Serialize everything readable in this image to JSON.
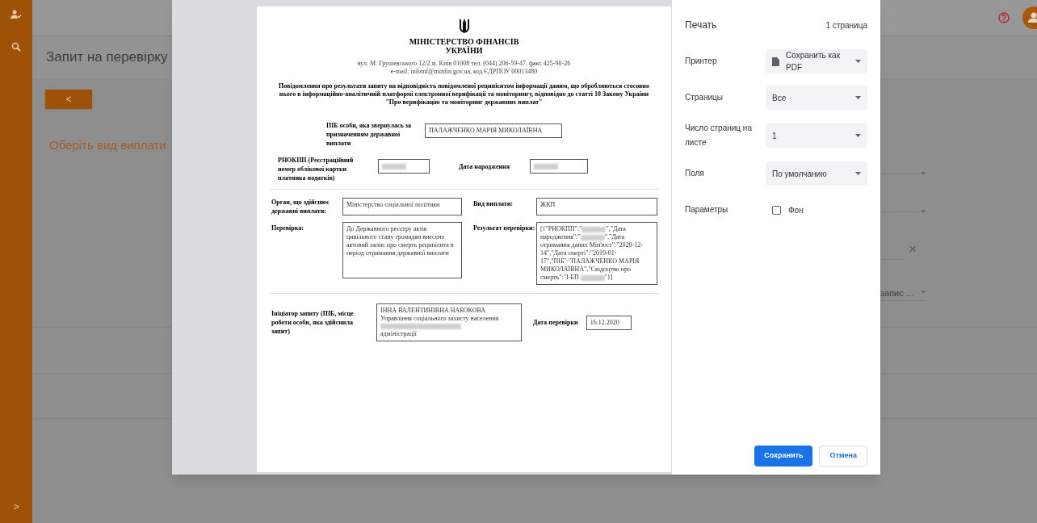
{
  "app": {
    "title": "Запит на перевірку",
    "back_button": "<",
    "section_label": "Оберіть вид виплати",
    "clear_button": "×",
    "truncated_value": "запис ...",
    "expand_button": ">"
  },
  "document": {
    "org_name": [
      "МІНІСТЕРСТВО ФІНАНСІВ",
      "УКРАЇНИ"
    ],
    "address": [
      "вул. М. Грушевського 12/2 м. Київ 01008 тел. (044) 206-59-47, факс 425-90-26",
      "e-mail: infomf@minfin.gov.ua, код ЄДРПОУ 00013480"
    ],
    "heading": "Повідомлення про результати запиту на відповідність повідомленої реципієнтом інформації даним, що обробляються стосовно нього в інформаційно-аналітичній платформі електронної верифікації та моніторингу, відповідно до статті 10 Закону України \"Про верифікацію та моніторинг державних виплат\"",
    "applicant": {
      "label": "ПІБ особи, яка звернулась за призначенням державної виплати",
      "value": [
        {
          "kind": "text",
          "text": "ПАЛАЖЧЕНКО МАРІЯ МИКОЛАЇВНА"
        }
      ]
    },
    "tax_id": {
      "label": "РНОКПП (Реєстраційний номер облікової картки платника податків)",
      "value": [
        {
          "kind": "redacted"
        }
      ]
    },
    "birth_date": {
      "label": "Дата народження",
      "value": [
        {
          "kind": "redacted"
        }
      ]
    },
    "payer": {
      "label": "Орган, що здійснює державні виплати:",
      "value": [
        {
          "kind": "text",
          "text": "Міністерство соціальної політики"
        }
      ]
    },
    "payment_type": {
      "label": "Вид виплати:",
      "value": [
        {
          "kind": "text",
          "text": "ЖКП"
        }
      ]
    },
    "check": {
      "label": "Перевірка:",
      "value": [
        {
          "kind": "text",
          "text": "До Державного реєстру актів цивільного стану громадян внесено актовий запис про смерть реципієнта в період отримання державної виплати"
        }
      ]
    },
    "result": {
      "label": "Результат перевірки:",
      "value": [
        {
          "kind": "text",
          "text": "[{\"РНОКПП\":\""
        },
        {
          "kind": "redacted"
        },
        {
          "kind": "text",
          "text": "\",\"Дата народження\":\""
        },
        {
          "kind": "redacted"
        },
        {
          "kind": "text",
          "text": "\",\"Дата отримання даних Мін'юст\":\"2020-12-14\",\"Дата смерті\":\"2019-01-17\",\"ПІБ\":\"ПАЛАЖЧЕНКО МАРІЯ МИКОЛАЇВНА\",\"Свідоцтво про смерть\":\"I-БП "
        },
        {
          "kind": "redacted"
        },
        {
          "kind": "text",
          "text": "\"}]"
        }
      ]
    },
    "initiator": {
      "label": "Ініціатор запиту (ПІБ, місце роботи особи, яка здійснила запит)",
      "value": [
        {
          "kind": "line",
          "text": "ІННА ВАЛЕНТИНІВНА НАБОКОВА"
        },
        {
          "kind": "line",
          "text": "Управління соціального захисту населення"
        },
        {
          "kind": "redacted_line"
        },
        {
          "kind": "line",
          "text": "адміністрації"
        }
      ]
    },
    "check_date": {
      "label": "Дата перевірки",
      "value": [
        {
          "kind": "text",
          "text": "16.12.2020"
        }
      ]
    }
  },
  "print_dialog": {
    "title": "Печать",
    "page_count": "1 страница",
    "settings": [
      {
        "label": "Принтер",
        "kind": "printer_select",
        "value": "Сохранить как PDF"
      },
      {
        "label": "Страницы",
        "kind": "select",
        "value": "Все"
      },
      {
        "label": "Число страниц на листе",
        "kind": "select",
        "value": "1"
      },
      {
        "label": "Поля",
        "kind": "select",
        "value": "По умолчанию"
      },
      {
        "label": "Параметры",
        "kind": "checkbox",
        "option": "Фон",
        "checked": false
      }
    ],
    "buttons": [
      {
        "label": "Сохранить",
        "kind": "primary"
      },
      {
        "label": "Отмена",
        "kind": "secondary"
      }
    ]
  }
}
